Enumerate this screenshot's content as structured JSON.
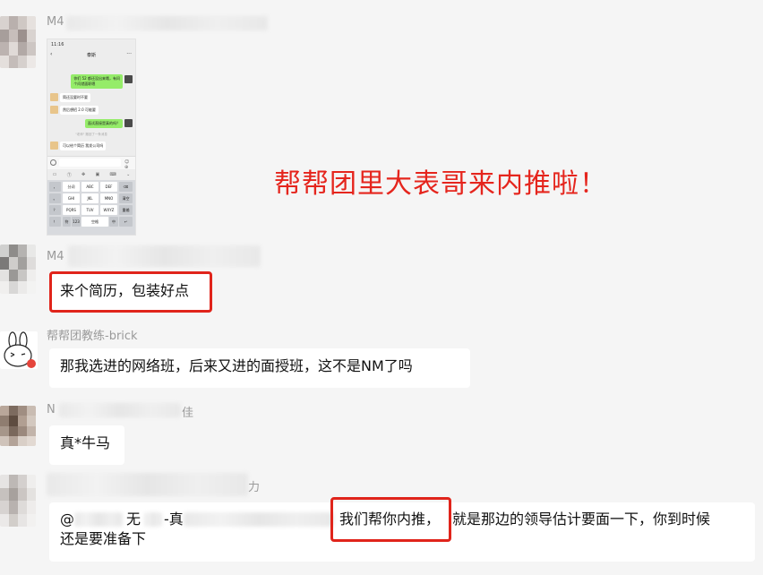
{
  "overlay_caption": "帮帮团里大表哥来内推啦！",
  "phone_screenshot": {
    "status_time": "11:16",
    "chat_title": "泰斯",
    "back_icon": "chevron-left-icon",
    "more_icon": "more-icon",
    "messages": [
      {
        "text": "你们 52 都还没出来哦，有问",
        "text2": "个问就面职嗯",
        "side": "right"
      },
      {
        "text": "简还没要时不要",
        "side": "left"
      },
      {
        "text": "然后想招 2.0 可能要",
        "side": "left"
      },
      {
        "text": "面试直接是真的吗？",
        "side": "right"
      },
      {
        "text": "可以给个简历  我发公司吗",
        "side": "left"
      }
    ],
    "system_note": "\"老师\" 撤回了一条消息",
    "toolbar_icons": [
      "copy-icon",
      "text-icon",
      "move-icon",
      "image-icon",
      "keyboard-icon",
      "chevron-down-icon"
    ],
    "keys": {
      "row1": [
        "，",
        "分词",
        "ABC",
        "DEF",
        "⌫"
      ],
      "row2": [
        "。",
        "GHI",
        "JKL",
        "MNO",
        "清空"
      ],
      "row3": [
        "？",
        "PQRS",
        "TUV",
        "WXYZ",
        "重输"
      ],
      "row4": [
        "！",
        "符",
        "123",
        "空格",
        "中",
        "↵"
      ]
    }
  },
  "messages": [
    {
      "sender": "M4",
      "text": "来个简历，包装好点",
      "highlighted": true
    },
    {
      "sender": "帮帮团教练-brick",
      "text": "那我选进的网络班，后来又进的面授班，这不是NM了吗",
      "highlighted": false
    },
    {
      "sender": "N",
      "sender_tail": "佳",
      "text": "真*牛马",
      "highlighted": false
    },
    {
      "sender_tail": "力",
      "text_prefix": "@",
      "text_mid": "无",
      "text_mid2": "-真",
      "highlight_text": "我们帮你内推，",
      "text_after": "就是那边的领导估计要面一下，你到时候",
      "text_line2": "还是要准备下"
    }
  ],
  "first_sender": "M4",
  "colors": {
    "accent_red": "#e0241b",
    "wechat_green": "#95ec69",
    "bubble_bg": "#ffffff",
    "chat_bg": "#f5f5f5"
  }
}
